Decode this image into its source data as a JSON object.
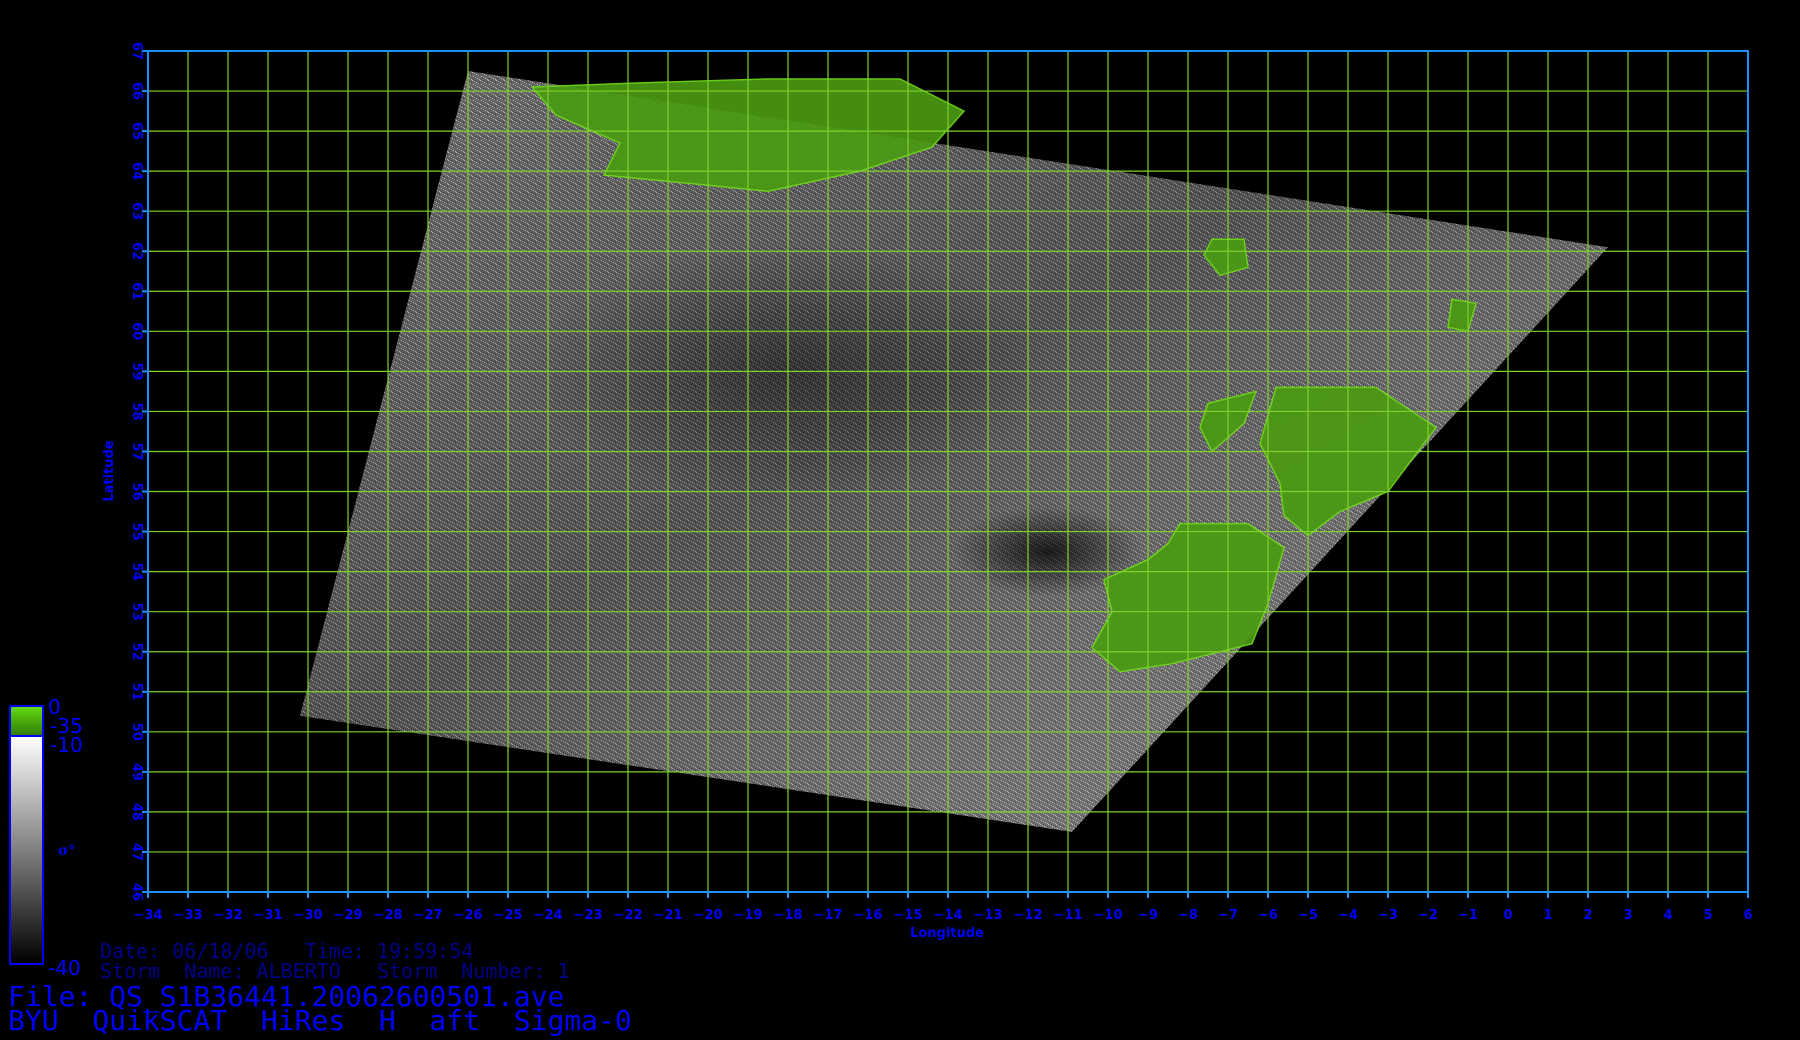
{
  "map": {
    "lon_range": [
      -34,
      6
    ],
    "lat_range": [
      46,
      67
    ],
    "lon_ticks": [
      "-34",
      "-33",
      "-32",
      "-31",
      "-30",
      "-29",
      "-28",
      "-27",
      "-26",
      "-25",
      "-24",
      "-23",
      "-22",
      "-21",
      "-20",
      "-19",
      "-18",
      "-17",
      "-16",
      "-15",
      "-14",
      "-13",
      "-12",
      "-11",
      "-10",
      "-9",
      "-8",
      "-7",
      "-6",
      "-5",
      "-4",
      "-3",
      "-2",
      "-1",
      "0",
      "1",
      "2",
      "3",
      "4",
      "5",
      "6"
    ],
    "lat_ticks": [
      "46",
      "47",
      "48",
      "49",
      "50",
      "51",
      "52",
      "53",
      "54",
      "55",
      "56",
      "57",
      "58",
      "59",
      "60",
      "61",
      "62",
      "63",
      "64",
      "65",
      "66",
      "67"
    ],
    "xlabel": "Longitude",
    "ylabel": "Latitude",
    "grid": true,
    "grid_color": "#7fd12a",
    "frame_color": "#1e90ff",
    "land_color": "#4a9a12",
    "label_color": "#0000ff",
    "swath_corners_lonlat": [
      [
        -26,
        66.5
      ],
      [
        2.5,
        62.1
      ],
      [
        -10.9,
        47.5
      ],
      [
        -30.2,
        50.4
      ]
    ],
    "land_areas": [
      {
        "name": "Iceland",
        "outline_lonlat": [
          [
            -24.4,
            66.1
          ],
          [
            -21.8,
            66.2
          ],
          [
            -18.5,
            66.3
          ],
          [
            -15.2,
            66.3
          ],
          [
            -13.6,
            65.5
          ],
          [
            -14.4,
            64.6
          ],
          [
            -16.2,
            64.0
          ],
          [
            -18.5,
            63.5
          ],
          [
            -20.5,
            63.7
          ],
          [
            -22.6,
            63.9
          ],
          [
            -22.2,
            64.7
          ],
          [
            -23.8,
            65.4
          ]
        ]
      },
      {
        "name": "Faroe Islands",
        "outline_lonlat": [
          [
            -7.4,
            62.3
          ],
          [
            -6.6,
            62.3
          ],
          [
            -6.5,
            61.6
          ],
          [
            -7.2,
            61.4
          ],
          [
            -7.6,
            61.9
          ]
        ]
      },
      {
        "name": "Shetland",
        "outline_lonlat": [
          [
            -1.4,
            60.8
          ],
          [
            -0.8,
            60.7
          ],
          [
            -1.0,
            60.0
          ],
          [
            -1.5,
            60.1
          ]
        ]
      },
      {
        "name": "Scotland",
        "outline_lonlat": [
          [
            -5.8,
            58.6
          ],
          [
            -3.3,
            58.6
          ],
          [
            -1.8,
            57.6
          ],
          [
            -3.0,
            56.0
          ],
          [
            -4.2,
            55.5
          ],
          [
            -5.0,
            54.9
          ],
          [
            -5.6,
            55.4
          ],
          [
            -5.7,
            56.2
          ],
          [
            -6.2,
            57.2
          ]
        ]
      },
      {
        "name": "Outer Hebrides",
        "outline_lonlat": [
          [
            -7.5,
            58.2
          ],
          [
            -6.3,
            58.5
          ],
          [
            -6.6,
            57.7
          ],
          [
            -7.4,
            57.0
          ],
          [
            -7.7,
            57.6
          ]
        ]
      },
      {
        "name": "Ireland",
        "outline_lonlat": [
          [
            -8.2,
            55.2
          ],
          [
            -6.5,
            55.2
          ],
          [
            -5.6,
            54.6
          ],
          [
            -6.0,
            53.2
          ],
          [
            -6.4,
            52.2
          ],
          [
            -8.4,
            51.7
          ],
          [
            -9.7,
            51.5
          ],
          [
            -10.4,
            52.1
          ],
          [
            -9.9,
            53.0
          ],
          [
            -10.1,
            53.8
          ],
          [
            -9.0,
            54.3
          ],
          [
            -8.5,
            54.7
          ]
        ]
      }
    ],
    "dark_patch_lonlat": [
      -11.5,
      54.5
    ]
  },
  "colorbar": {
    "land_segment": {
      "top_label": "0",
      "bottom_label": "-35",
      "color": "#5acf12"
    },
    "sigma_segment": {
      "top_label": "-10",
      "bottom_label": "-40"
    },
    "quantity_label": "σ°"
  },
  "info": {
    "date_line": "Date: 06/18/06   Time: 19:59:54",
    "storm_line": "Storm  Name: ALBERTO   Storm  Number: 1",
    "file_line": "File: QS_S1B36441.20062600501.ave",
    "product_line": "BYU  QuikSCAT  HiRes  H  aft  Sigma-0"
  }
}
